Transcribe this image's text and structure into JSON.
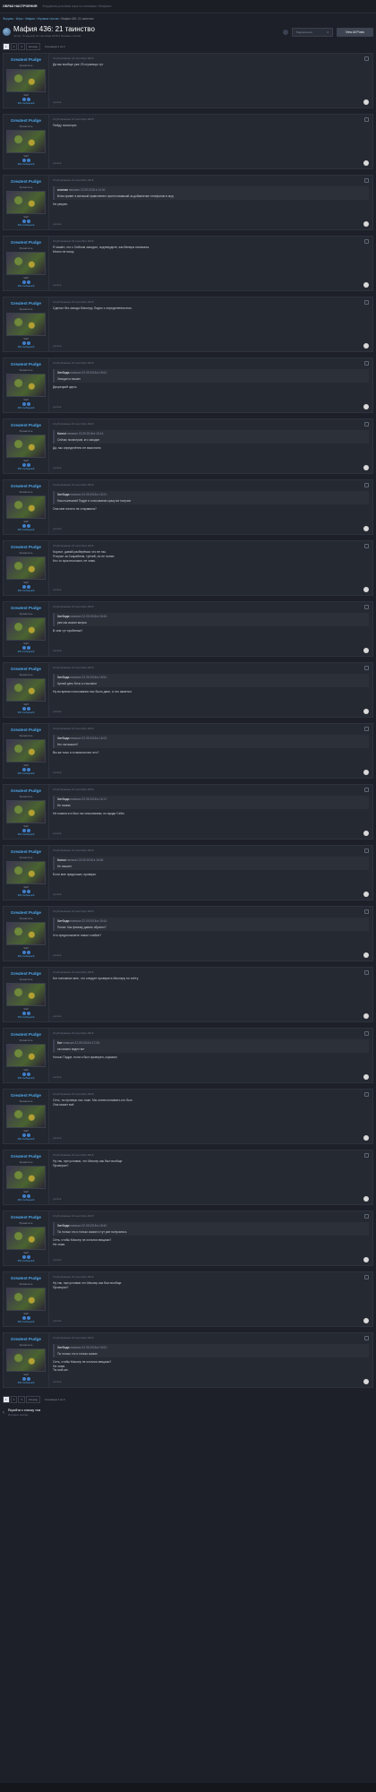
{
  "topbar": {
    "brand": "ОБРАЗ НАСТРОЕНИЯ",
    "subtitle": "Форумная ролевая игра по мотивам «Мафии»"
  },
  "breadcrumb": {
    "items": [
      "Форумы",
      "Игры",
      "Мафия",
      "Игровые сессии"
    ],
    "last": "Мафия 436: 21 таинство"
  },
  "topic": {
    "title": "Мафия 436: 21 таинство",
    "meta": "Автор: Голодный, 21 сентября 2018 в Игровые сессии",
    "follow_label": "Подписаться",
    "follow_count": "3",
    "viewall_label": "View All Posts"
  },
  "pagination": {
    "pages": [
      "1",
      "2",
      "3"
    ],
    "next_label": "вперед",
    "summary": "Страница 1 из 3"
  },
  "author": {
    "name": "Greatest Pudge",
    "rank": "Хранитель",
    "staff": "Staff",
    "count": "966 сообщений"
  },
  "posts": [
    {
      "date": "Опубликовано 22 сентября 2018",
      "text": "Да мы вообще уже 23 страницы тут",
      "quote": null,
      "quote_label": "цитата"
    },
    {
      "date": "Опубликовано 22 сентября 2018",
      "text": "Пойду посмотрю",
      "quote": null,
      "quote_label": "цитата"
    },
    {
      "date": "Опубликовано 22 сентября 2018",
      "text": "Не уверен.",
      "quote": {
        "author": "аноним",
        "date": "написал 22.09.2018 в 14:20:",
        "text": "Всем привет я мельный нравственно протестовавший за добавление телефонов в игру"
      },
      "quote_label": "цитата"
    },
    {
      "date": "Опубликовано 22 сентября 2018",
      "text": "Я зашёл, кто с Сейлом заходил, подтвердите, как Венера написала.\nМного не пишу.",
      "quote": null,
      "quote_label": "цитата"
    },
    {
      "date": "Опубликовано 22 сентября 2018",
      "text": "Сделал без захода Миссеру, Ладно с определенностью.",
      "quote": null,
      "quote_label": "цитата"
    },
    {
      "date": "Опубликовано 22 сентября 2018",
      "text": "Дворецкий здесь",
      "quote": {
        "author": "Хитбоди",
        "date": "написал 22.09.2018 в 15:02:",
        "text": "Заходил и вышел"
      },
      "quote_label": "цитата"
    },
    {
      "date": "Опубликовано 22 сентября 2018",
      "text": "Да, мы определённо не выяснили",
      "quote": {
        "author": "Kamui",
        "date": "написал 22.09.2018 в 15:14:",
        "text": "Сейчас посмотрим, кто заходил"
      },
      "quote_label": "цитата"
    },
    {
      "date": "Опубликовано 22 сентября 2018",
      "text": "Она мне ничего не отправила?",
      "quote": {
        "author": "Хитбоди",
        "date": "написал 22.09.2018 в 15:21:",
        "text": "Наш нынешний Падре в голосовании сразу же получил"
      },
      "quote_label": "цитата"
    },
    {
      "date": "Опубликовано 22 сентября 2018",
      "text": "Короче, давай разберёмся что не так.\nЯ играл за Скарабеем, третий, но не понял.\nКто-то проголосовал, не знаю.",
      "quote": null,
      "quote_label": "цитата"
    },
    {
      "date": "Опубликовано 22 сентября 2018",
      "text": "В чем тут проблема?",
      "quote": {
        "author": "Хитбоди",
        "date": "написал 22.09.2018 в 15:40:",
        "text": "уже как сказал вопрос"
      },
      "quote_label": "цитата"
    },
    {
      "date": "Опубликовано 22 сентября 2018",
      "text": "Ну во время голосования нас было двое, я это заметил.",
      "quote": {
        "author": "Хитбоди",
        "date": "написал 22.09.2018 в 15:51:",
        "text": "Целый день боты и отсылали"
      },
      "quote_label": "цитата"
    },
    {
      "date": "Опубликовано 22 сентября 2018",
      "text": "Вы же ночь я и написал вот кто?",
      "quote": {
        "author": "Хитбоди",
        "date": "написал 22.09.2018 в 16:03:",
        "text": "Кто так вышел?"
      },
      "quote_label": "цитата"
    },
    {
      "date": "Опубликовано 22 сентября 2018",
      "text": "Не помню кто был на голосовании, но вроде Сейл.",
      "quote": {
        "author": "Хитбоди",
        "date": "написал 22.09.2018 в 16:17:",
        "text": "Не помню"
      },
      "quote_label": "цитата"
    },
    {
      "date": "Опубликовано 22 сентября 2018",
      "text": "Если мне предложат, проверю.",
      "quote": {
        "author": "Kamui",
        "date": "написал 22.09.2018 в 16:30:",
        "text": "Не пишите"
      },
      "quote_label": "цитата"
    },
    {
      "date": "Опубликовано 22 сентября 2018",
      "text": "Что предполагаете новое слабое?",
      "quote": {
        "author": "Хитбоди",
        "date": "написал 22.09.2018 в 16:44:",
        "text": "Понял. Как фильму давать обратно?"
      },
      "quote_label": "цитата"
    },
    {
      "date": "Опубликовано 22 сентября 2018",
      "text": "Кот напомнил мне, что следует проверить Миссеру по счёту.",
      "quote": null,
      "quote_label": "цитата"
    },
    {
      "date": "Опубликовано 22 сентября 2018",
      "text": "Ночью Падре, если и был проверен, скрывал",
      "quote": {
        "author": "Кот",
        "date": "написал 22.09.2018 в 17:05:",
        "text": "так можно видел вот"
      },
      "quote_label": "цитата"
    },
    {
      "date": "Опубликовано 22 сентября 2018",
      "text": "Сеть, ты проверь нас тоже. Мы хотим понимать кто был.\nОна может всё.",
      "quote": null,
      "quote_label": "цитата"
    },
    {
      "date": "Опубликовано 22 сентября 2018",
      "text": "Ну так, при условии, что Миссер как был вообще\nПроверял?",
      "quote": null,
      "quote_label": "цитата"
    },
    {
      "date": "Опубликовано 22 сентября 2018",
      "text": "Сеть, чтобы Миссер не остался вещами?\nНе знаю.",
      "quote": {
        "author": "Хитбоди",
        "date": "написал 22.09.2018 в 18:40:",
        "text": "Ты только что и только сказал и тут уже получилось"
      },
      "quote_label": "цитата"
    },
    {
      "date": "Опубликовано 22 сентября 2018",
      "text": "Ну так, при условии что Миссер как был вообще.\nПроверял?",
      "quote": null,
      "quote_label": "цитата"
    },
    {
      "date": "Опубликовано 22 сентября 2018",
      "text": "Сеть, чтобы Миссер не остался вещами?\nНе знаю.\nТы мой-же.",
      "quote": {
        "author": "Хитбоди",
        "date": "написал 22.09.2018 в 19:02:",
        "text": "Ты только что и только сказал"
      },
      "quote_label": "цитата"
    }
  ],
  "bottom": {
    "back_label": "Перейти к списку тем",
    "back_sub": "Игровые сессии"
  }
}
